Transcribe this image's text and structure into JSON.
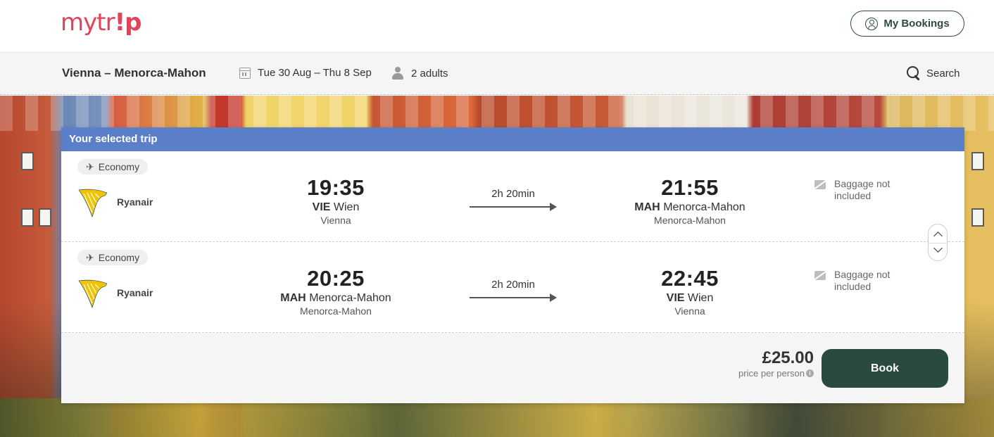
{
  "header": {
    "logo_text_a": "mytr",
    "logo_text_b": "!p",
    "my_bookings_label": "My Bookings"
  },
  "search": {
    "route": "Vienna – Menorca-Mahon",
    "dates": "Tue 30 Aug – Thu 8 Sep",
    "passengers": "2 adults",
    "search_label": "Search"
  },
  "trip": {
    "title": "Your selected trip",
    "legs": [
      {
        "cabin": "Economy",
        "airline": "Ryanair",
        "dep_time": "19:35",
        "dep_code": "VIE",
        "dep_airport": "Wien",
        "dep_city": "Vienna",
        "duration": "2h 20min",
        "arr_time": "21:55",
        "arr_code": "MAH",
        "arr_airport": "Menorca-Mahon",
        "arr_city": "Menorca-Mahon",
        "baggage_line1": "Baggage not",
        "baggage_line2": "included"
      },
      {
        "cabin": "Economy",
        "airline": "Ryanair",
        "dep_time": "20:25",
        "dep_code": "MAH",
        "dep_airport": "Menorca-Mahon",
        "dep_city": "Menorca-Mahon",
        "duration": "2h 20min",
        "arr_time": "22:45",
        "arr_code": "VIE",
        "arr_airport": "Wien",
        "arr_city": "Vienna",
        "baggage_line1": "Baggage not",
        "baggage_line2": "included"
      }
    ],
    "price": "£25.00",
    "price_note": "price per person",
    "book_label": "Book"
  },
  "colors": {
    "brand": "#e0445a",
    "accent_dark_green": "#294a3d",
    "trip_header_blue": "#5c7fc9"
  },
  "icons": [
    "user-circle-icon",
    "calendar-icon",
    "person-icon",
    "search-icon",
    "plane-icon",
    "ryanair-harp-icon",
    "baggage-icon",
    "chevron-up-icon",
    "chevron-down-icon",
    "info-icon"
  ]
}
